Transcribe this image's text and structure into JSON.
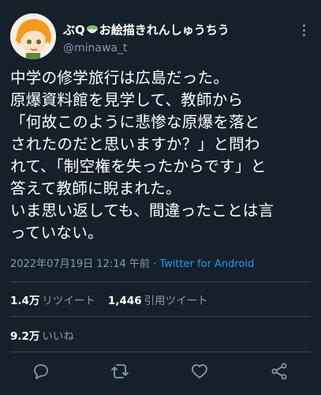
{
  "author": {
    "name_prefix": "ぶQ",
    "name_suffix": "お絵描きれんしゅうちう",
    "handle": "@minawa_t"
  },
  "tweet": {
    "text": "中学の修学旅行は広島だった。\n原爆資料館を見学して、教師から\n「何故このように悲惨な原爆を落と\nされたのだと思いますか？」と問わ\nれて、「制空権を失ったからです」と\n答えて教師に睨まれた。\nいま思い返しても、間違ったことは言\nっていない。",
    "timestamp": "2022年07月19日 12:14 午前",
    "separator": "·",
    "source": "Twitter for Android"
  },
  "stats": {
    "retweets_count": "1.4万",
    "retweets_label": "リツイート",
    "quotes_count": "1,446",
    "quotes_label": "引用ツイート",
    "likes_count": "9.2万",
    "likes_label": "いいね"
  },
  "actions": {
    "reply_icon": "reply-icon",
    "retweet_icon": "retweet-icon",
    "like_icon": "heart-icon",
    "share_icon": "share-icon"
  },
  "colors": {
    "background": "#15202b",
    "text": "#ffffff",
    "secondary": "#8b98a5",
    "link": "#1d9bf0",
    "divider": "#38444d"
  }
}
